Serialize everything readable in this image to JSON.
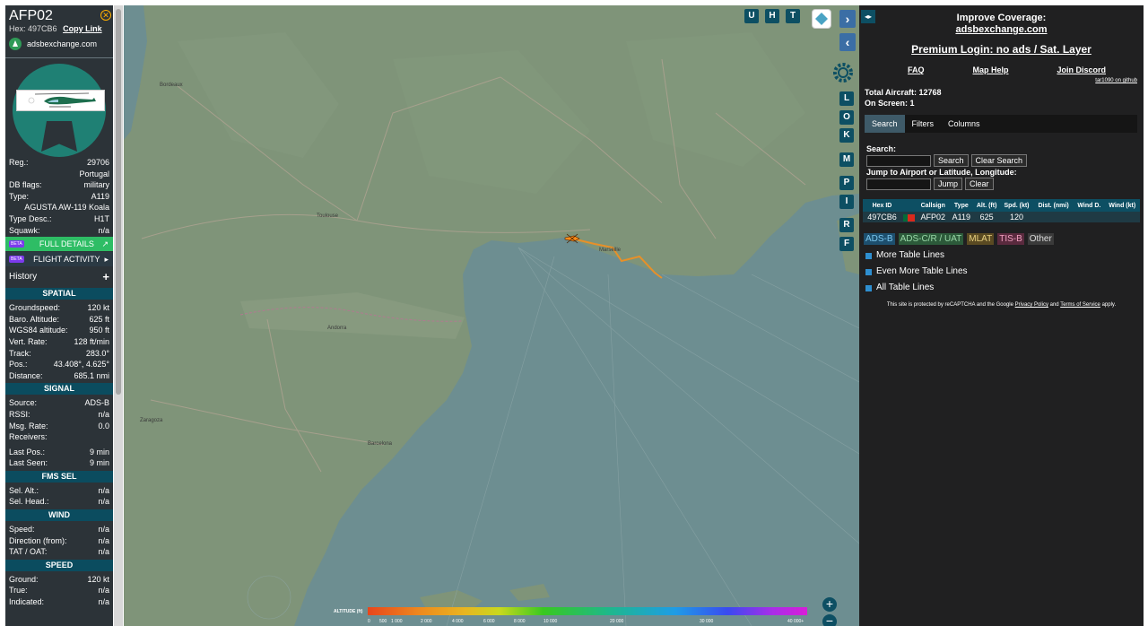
{
  "aircraft": {
    "callsign": "AFP02",
    "hex_label": "Hex:",
    "hex": "497CB6",
    "copy_link": "Copy Link",
    "brand": "adsbexchange.com"
  },
  "info_rows": [
    {
      "k": "Reg.:",
      "v": "29706"
    },
    {
      "k": "",
      "v": "Portugal"
    },
    {
      "k": "DB flags:",
      "v": "military"
    },
    {
      "k": "Type:",
      "v": "A119"
    },
    {
      "k": "",
      "v": "AGUSTA AW-119 Koala"
    },
    {
      "k": "Type Desc.:",
      "v": "H1T"
    },
    {
      "k": "Squawk:",
      "v": "n/a"
    }
  ],
  "buttons": {
    "full_details": "FULL DETAILS",
    "flight_activity": "FLIGHT ACTIVITY",
    "beta": "BETA",
    "history": "History",
    "history_icon": "+"
  },
  "sections": [
    {
      "title": "SPATIAL",
      "rows": [
        {
          "k": "Groundspeed:",
          "v": "120 kt"
        },
        {
          "k": "Baro. Altitude:",
          "v": "625 ft"
        },
        {
          "k": "WGS84 altitude:",
          "v": "950 ft"
        },
        {
          "k": "Vert. Rate:",
          "v": "128 ft/min"
        },
        {
          "k": "Track:",
          "v": "283.0°"
        },
        {
          "k": "Pos.:",
          "v": "43.408°, 4.625°"
        },
        {
          "k": "Distance:",
          "v": "685.1 nmi"
        }
      ]
    },
    {
      "title": "SIGNAL",
      "rows": [
        {
          "k": "Source:",
          "v": "ADS-B"
        },
        {
          "k": "RSSI:",
          "v": "n/a"
        },
        {
          "k": "Msg. Rate:",
          "v": "0.0"
        },
        {
          "k": "Receivers:",
          "v": ""
        },
        {
          "k": "Last Pos.:",
          "v": "9 min"
        },
        {
          "k": "Last Seen:",
          "v": "9 min"
        }
      ]
    },
    {
      "title": "FMS SEL",
      "rows": [
        {
          "k": "Sel. Alt.:",
          "v": "n/a"
        },
        {
          "k": "Sel. Head.:",
          "v": "n/a"
        }
      ]
    },
    {
      "title": "WIND",
      "rows": [
        {
          "k": "Speed:",
          "v": "n/a"
        },
        {
          "k": "Direction (from):",
          "v": "n/a"
        },
        {
          "k": "TAT / OAT:",
          "v": "n/a"
        }
      ]
    },
    {
      "title": "SPEED",
      "rows": [
        {
          "k": "Ground:",
          "v": "120 kt"
        },
        {
          "k": "True:",
          "v": "n/a"
        },
        {
          "k": "Indicated:",
          "v": "n/a"
        }
      ]
    }
  ],
  "map": {
    "labels": [
      "Bordeaux",
      "Toulouse",
      "Andorra",
      "Barcelona",
      "Zaragoza",
      "Marseille"
    ],
    "toolbar_top": [
      "U",
      "H",
      "T"
    ],
    "toolbar_side": [
      "L",
      "O",
      "K",
      "M",
      "P",
      "I",
      "R",
      "F"
    ],
    "zoom_in": "+",
    "zoom_out": "−",
    "altitude_title": "ALTITUDE (ft)",
    "altitude_ticks": [
      "0",
      "500",
      "1 000",
      "2 000",
      "4 000",
      "6 000",
      "8 000",
      "10 000",
      "20 000",
      "30 000",
      "40 000+"
    ]
  },
  "right": {
    "improve_title": "Improve Coverage:",
    "improve_link": "adsbexchange.com",
    "premium": "Premium Login: no ads / Sat. Layer",
    "faq": "FAQ",
    "map_help": "Map Help",
    "discord": "Join Discord",
    "github": "tar1090 on github",
    "total_label": "Total Aircraft:",
    "total": "12768",
    "onscreen_label": "On Screen:",
    "onscreen": "1",
    "tabs": [
      "Search",
      "Filters",
      "Columns"
    ],
    "search_label": "Search:",
    "search_btn": "Search",
    "clear_search_btn": "Clear Search",
    "jump_label": "Jump to Airport or Latitude, Longitude:",
    "jump_btn": "Jump",
    "clear_btn": "Clear",
    "table_headers": [
      "Hex ID",
      "",
      "Callsign",
      "Type",
      "Alt. (ft)",
      "Spd. (kt)",
      "Dist. (nmi)",
      "Wind D.",
      "Wind (kt)"
    ],
    "table_rows": [
      {
        "hex": "497CB6",
        "callsign": "AFP02",
        "type": "A119",
        "alt": "625",
        "spd": "120"
      }
    ],
    "sources": [
      {
        "label": "ADS-B",
        "bg": "#1d4f6e",
        "fg": "#7cc8f0"
      },
      {
        "label": "ADS-C/R / UAT",
        "bg": "#2c5a3a",
        "fg": "#9ad8a8"
      },
      {
        "label": "MLAT",
        "bg": "#5a4a22",
        "fg": "#e8d080"
      },
      {
        "label": "TIS-B",
        "bg": "#5a2a3e",
        "fg": "#f0a0c0"
      },
      {
        "label": "Other",
        "bg": "#3a3a3a",
        "fg": "#dddddd"
      }
    ],
    "options": [
      "More Table Lines",
      "Even More Table Lines",
      "All Table Lines"
    ],
    "recaptcha_pre": "This site is protected by reCAPTCHA and the Google",
    "privacy": "Privacy Policy",
    "and": "and",
    "terms": "Terms of Service",
    "apply": "apply."
  }
}
